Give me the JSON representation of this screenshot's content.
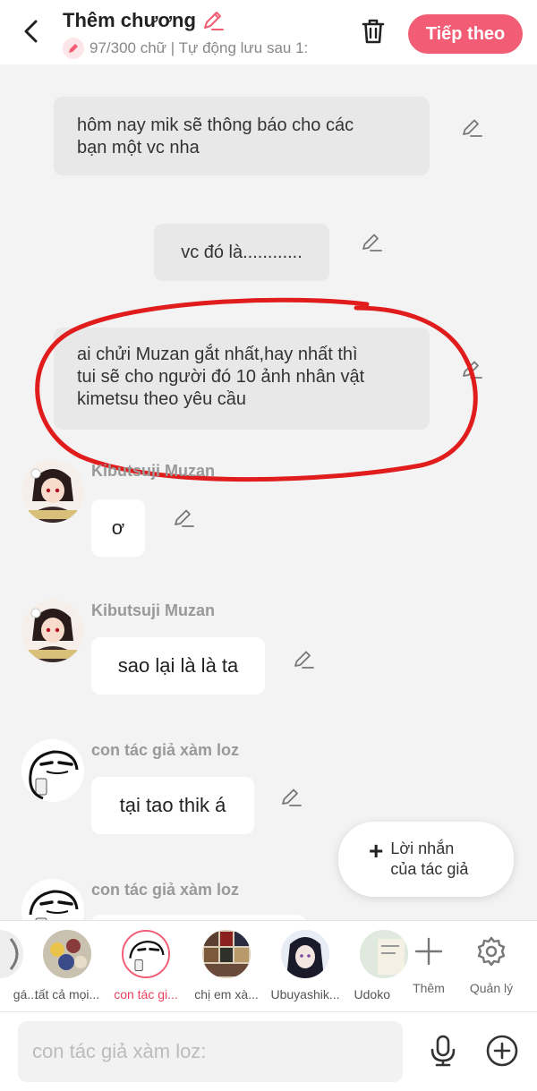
{
  "header": {
    "title": "Thêm chương",
    "subtitle": "97/300 chữ | Tự động lưu sau 1:",
    "next_label": "Tiếp theo"
  },
  "messages": {
    "narr1": [
      "hôm nay mik sẽ thông báo cho các",
      "bạn một vc nha"
    ],
    "narr2": "vc đó là............",
    "narr3": [
      "ai chửi Muzan gắt nhất,hay nhất thì",
      "tui sẽ cho người đó 10 ảnh nhân vật",
      "kimetsu theo yêu cầu"
    ],
    "speaker1": "Kibutsuji Muzan",
    "bubble1": "ơ",
    "speaker2": "Kibutsuji Muzan",
    "bubble2": "sao lại là là ta",
    "speaker3": "con tác giả xàm loz",
    "bubble3": "tại tao thik á",
    "speaker4": "con tác giả xàm loz"
  },
  "floating_note": {
    "line1": "Lời nhắn",
    "line2": "của tác giả"
  },
  "characters": [
    {
      "label": "gá..."
    },
    {
      "label": "tất cả mọi..."
    },
    {
      "label": "con tác gi..."
    },
    {
      "label": "chị em xà..."
    },
    {
      "label": "Ubuyashik..."
    },
    {
      "label": "Udoko"
    }
  ],
  "tools": {
    "add_label": "Thêm",
    "manage_label": "Quản lý"
  },
  "input": {
    "placeholder": "con tác giả xàm loz:"
  },
  "colors": {
    "accent": "#f25c75",
    "annotation_red": "#e01c1c"
  }
}
